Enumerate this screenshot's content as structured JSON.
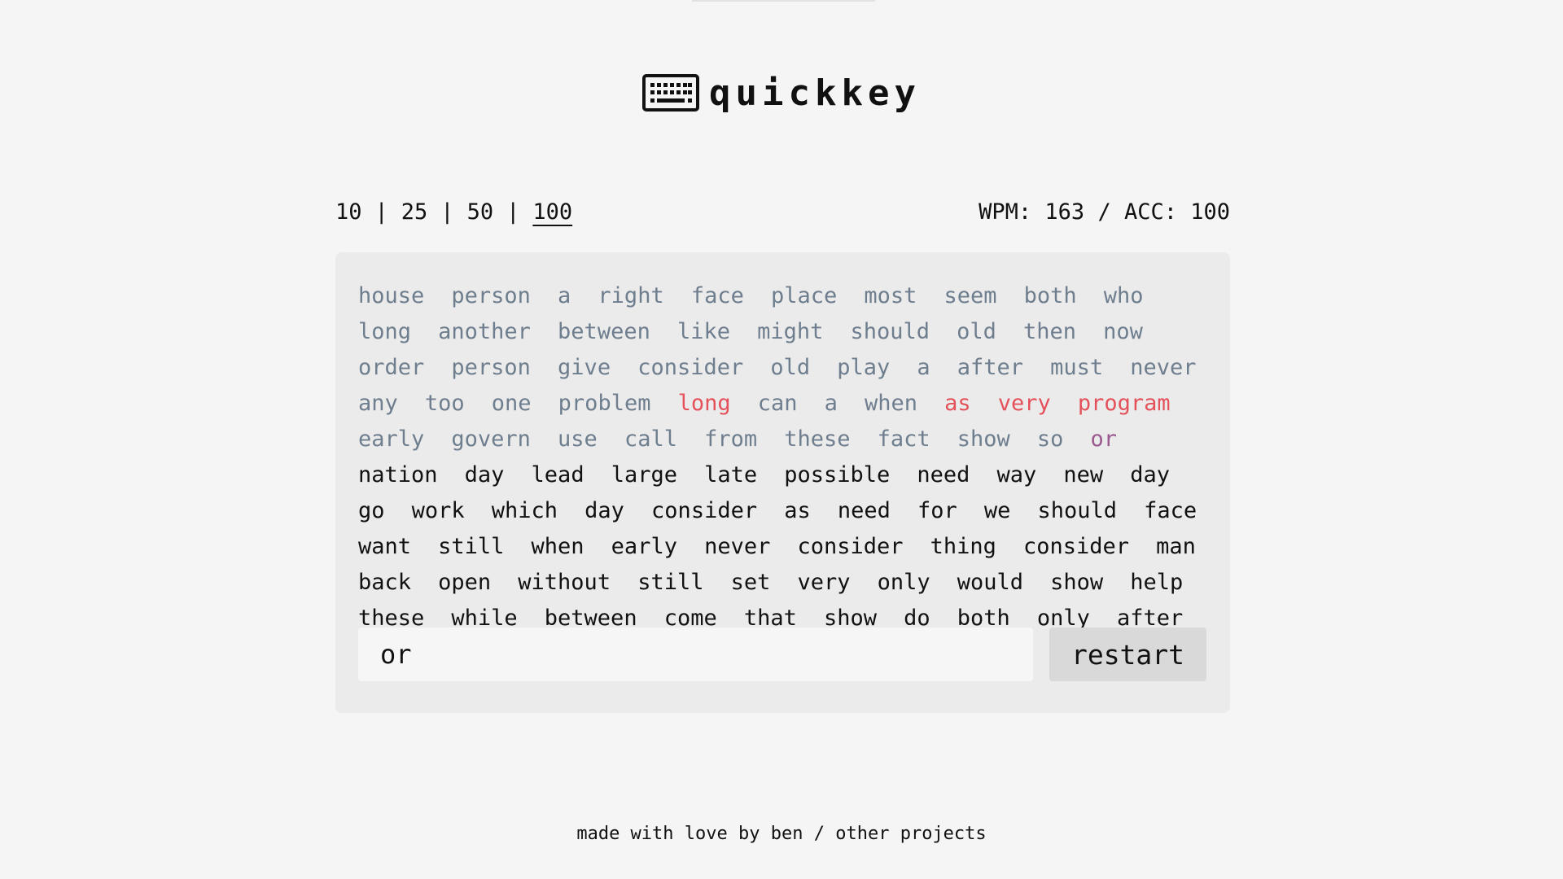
{
  "app": {
    "title": "quickkey",
    "logo_icon": "keyboard-icon"
  },
  "controls": {
    "word_counts": [
      "10",
      "25",
      "50",
      "100"
    ],
    "selected_count": "100",
    "separator": "|",
    "stats": "WPM: 163 / ACC: 100"
  },
  "colors": {
    "typed": "#6e7e8e",
    "error": "#e4515a",
    "current": "#9b5a8f",
    "pending": "#111111",
    "background": "#f5f5f5",
    "panel": "#ebebeb"
  },
  "words": [
    {
      "text": "house",
      "state": "typed"
    },
    {
      "text": "person",
      "state": "typed"
    },
    {
      "text": "a",
      "state": "typed"
    },
    {
      "text": "right",
      "state": "typed"
    },
    {
      "text": "face",
      "state": "typed"
    },
    {
      "text": "place",
      "state": "typed"
    },
    {
      "text": "most",
      "state": "typed"
    },
    {
      "text": "seem",
      "state": "typed"
    },
    {
      "text": "both",
      "state": "typed"
    },
    {
      "text": "who",
      "state": "typed"
    },
    {
      "text": "long",
      "state": "typed"
    },
    {
      "text": "another",
      "state": "typed"
    },
    {
      "text": "between",
      "state": "typed"
    },
    {
      "text": "like",
      "state": "typed"
    },
    {
      "text": "might",
      "state": "typed"
    },
    {
      "text": "should",
      "state": "typed"
    },
    {
      "text": "old",
      "state": "typed"
    },
    {
      "text": "then",
      "state": "typed"
    },
    {
      "text": "now",
      "state": "typed"
    },
    {
      "text": "order",
      "state": "typed"
    },
    {
      "text": "person",
      "state": "typed"
    },
    {
      "text": "give",
      "state": "typed"
    },
    {
      "text": "consider",
      "state": "typed"
    },
    {
      "text": "old",
      "state": "typed"
    },
    {
      "text": "play",
      "state": "typed"
    },
    {
      "text": "a",
      "state": "typed"
    },
    {
      "text": "after",
      "state": "typed"
    },
    {
      "text": "must",
      "state": "typed"
    },
    {
      "text": "never",
      "state": "typed"
    },
    {
      "text": "any",
      "state": "typed"
    },
    {
      "text": "too",
      "state": "typed"
    },
    {
      "text": "one",
      "state": "typed"
    },
    {
      "text": "problem",
      "state": "typed"
    },
    {
      "text": "long",
      "state": "error"
    },
    {
      "text": "can",
      "state": "typed"
    },
    {
      "text": "a",
      "state": "typed"
    },
    {
      "text": "when",
      "state": "typed"
    },
    {
      "text": "as",
      "state": "error"
    },
    {
      "text": "very",
      "state": "error"
    },
    {
      "text": "program",
      "state": "error"
    },
    {
      "text": "early",
      "state": "typed"
    },
    {
      "text": "govern",
      "state": "typed"
    },
    {
      "text": "use",
      "state": "typed"
    },
    {
      "text": "call",
      "state": "typed"
    },
    {
      "text": "from",
      "state": "typed"
    },
    {
      "text": "these",
      "state": "typed"
    },
    {
      "text": "fact",
      "state": "typed"
    },
    {
      "text": "show",
      "state": "typed"
    },
    {
      "text": "so",
      "state": "typed"
    },
    {
      "text": "or",
      "state": "current"
    },
    {
      "text": "nation",
      "state": "pending"
    },
    {
      "text": "day",
      "state": "pending"
    },
    {
      "text": "lead",
      "state": "pending"
    },
    {
      "text": "large",
      "state": "pending"
    },
    {
      "text": "late",
      "state": "pending"
    },
    {
      "text": "possible",
      "state": "pending"
    },
    {
      "text": "need",
      "state": "pending"
    },
    {
      "text": "way",
      "state": "pending"
    },
    {
      "text": "new",
      "state": "pending"
    },
    {
      "text": "day",
      "state": "pending"
    },
    {
      "text": "go",
      "state": "pending"
    },
    {
      "text": "work",
      "state": "pending"
    },
    {
      "text": "which",
      "state": "pending"
    },
    {
      "text": "day",
      "state": "pending"
    },
    {
      "text": "consider",
      "state": "pending"
    },
    {
      "text": "as",
      "state": "pending"
    },
    {
      "text": "need",
      "state": "pending"
    },
    {
      "text": "for",
      "state": "pending"
    },
    {
      "text": "we",
      "state": "pending"
    },
    {
      "text": "should",
      "state": "pending"
    },
    {
      "text": "face",
      "state": "pending"
    },
    {
      "text": "want",
      "state": "pending"
    },
    {
      "text": "still",
      "state": "pending"
    },
    {
      "text": "when",
      "state": "pending"
    },
    {
      "text": "early",
      "state": "pending"
    },
    {
      "text": "never",
      "state": "pending"
    },
    {
      "text": "consider",
      "state": "pending"
    },
    {
      "text": "thing",
      "state": "pending"
    },
    {
      "text": "consider",
      "state": "pending"
    },
    {
      "text": "man",
      "state": "pending"
    },
    {
      "text": "back",
      "state": "pending"
    },
    {
      "text": "open",
      "state": "pending"
    },
    {
      "text": "without",
      "state": "pending"
    },
    {
      "text": "still",
      "state": "pending"
    },
    {
      "text": "set",
      "state": "pending"
    },
    {
      "text": "very",
      "state": "pending"
    },
    {
      "text": "only",
      "state": "pending"
    },
    {
      "text": "would",
      "state": "pending"
    },
    {
      "text": "show",
      "state": "pending"
    },
    {
      "text": "help",
      "state": "pending"
    },
    {
      "text": "these",
      "state": "pending"
    },
    {
      "text": "while",
      "state": "pending"
    },
    {
      "text": "between",
      "state": "pending"
    },
    {
      "text": "come",
      "state": "pending"
    },
    {
      "text": "that",
      "state": "pending"
    },
    {
      "text": "show",
      "state": "pending"
    },
    {
      "text": "do",
      "state": "pending"
    },
    {
      "text": "both",
      "state": "pending"
    },
    {
      "text": "only",
      "state": "pending"
    },
    {
      "text": "after",
      "state": "pending"
    }
  ],
  "input": {
    "value": "or"
  },
  "restart_label": "restart",
  "footer": {
    "made_by": "made with love by ben",
    "separator": "/",
    "other_projects": "other projects"
  }
}
